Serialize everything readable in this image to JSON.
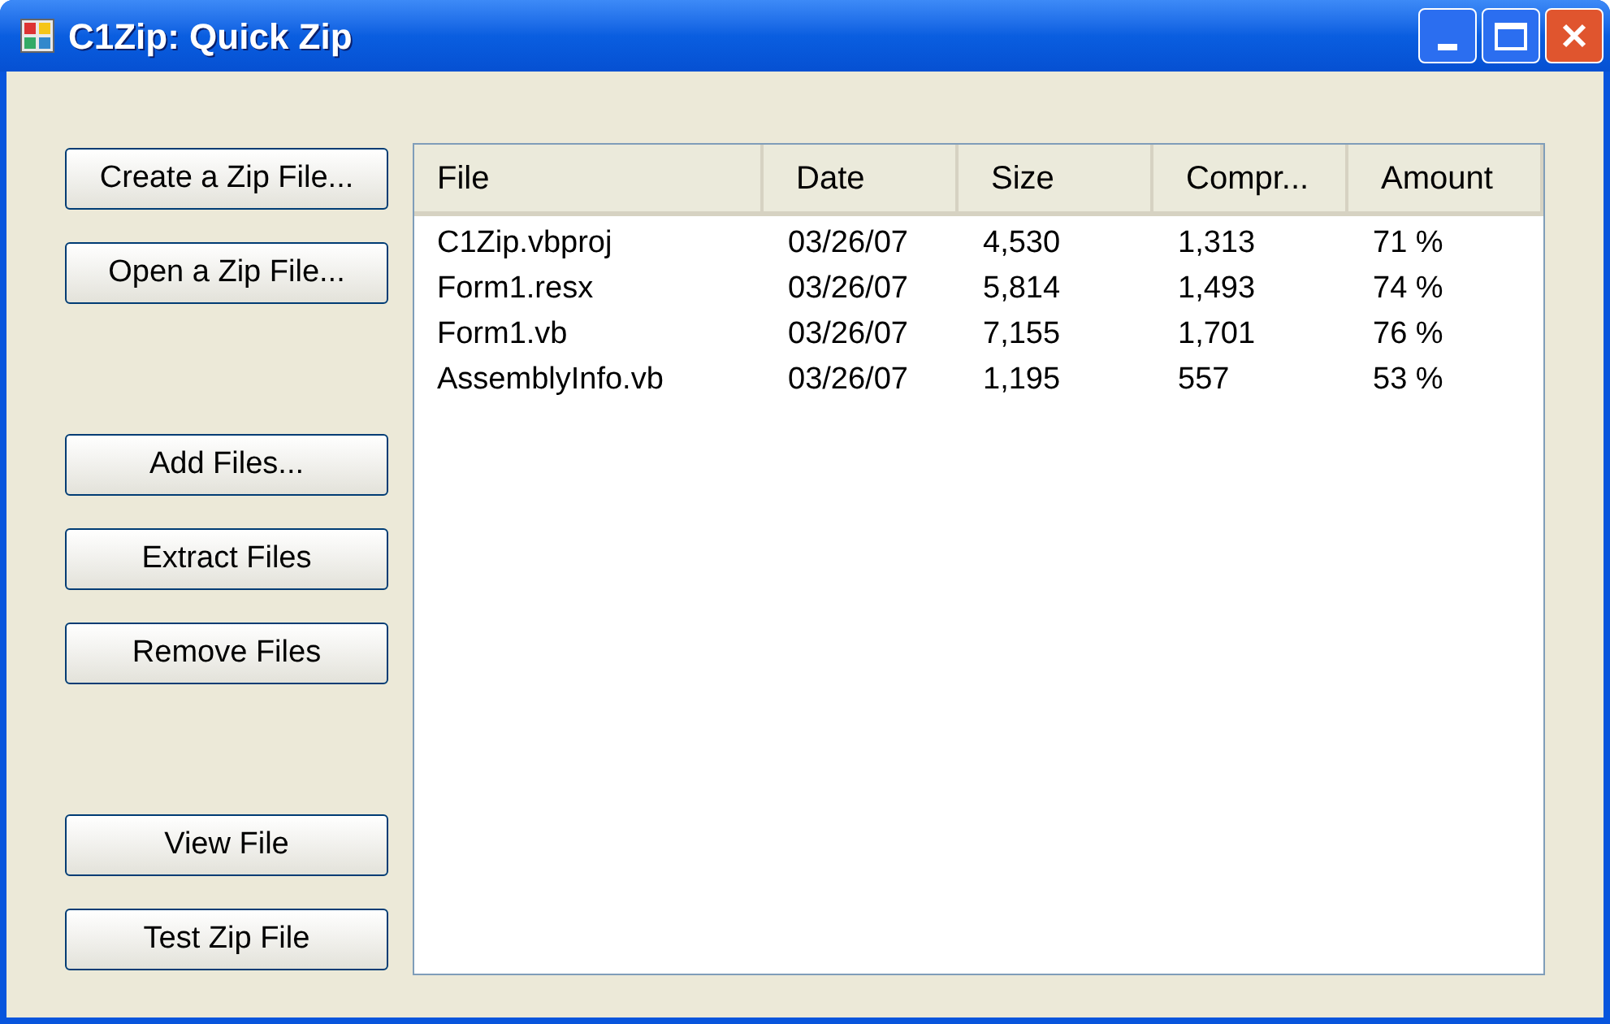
{
  "window": {
    "title": "C1Zip: Quick Zip"
  },
  "button_groups": [
    [
      "Create a Zip File...",
      "Open a Zip File..."
    ],
    [
      "Add Files...",
      "Extract Files",
      "Remove Files"
    ],
    [
      "View File",
      "Test Zip File"
    ]
  ],
  "file_list": {
    "columns": [
      "File",
      "Date",
      "Size",
      "Compr...",
      "Amount"
    ],
    "rows": [
      [
        "C1Zip.vbproj",
        "03/26/07",
        "4,530",
        "1,313",
        "71 %"
      ],
      [
        "Form1.resx",
        "03/26/07",
        "5,814",
        "1,493",
        "74 %"
      ],
      [
        "Form1.vb",
        "03/26/07",
        "7,155",
        "1,701",
        "76 %"
      ],
      [
        "AssemblyInfo.vb",
        "03/26/07",
        "1,195",
        "557",
        "53 %"
      ]
    ]
  }
}
